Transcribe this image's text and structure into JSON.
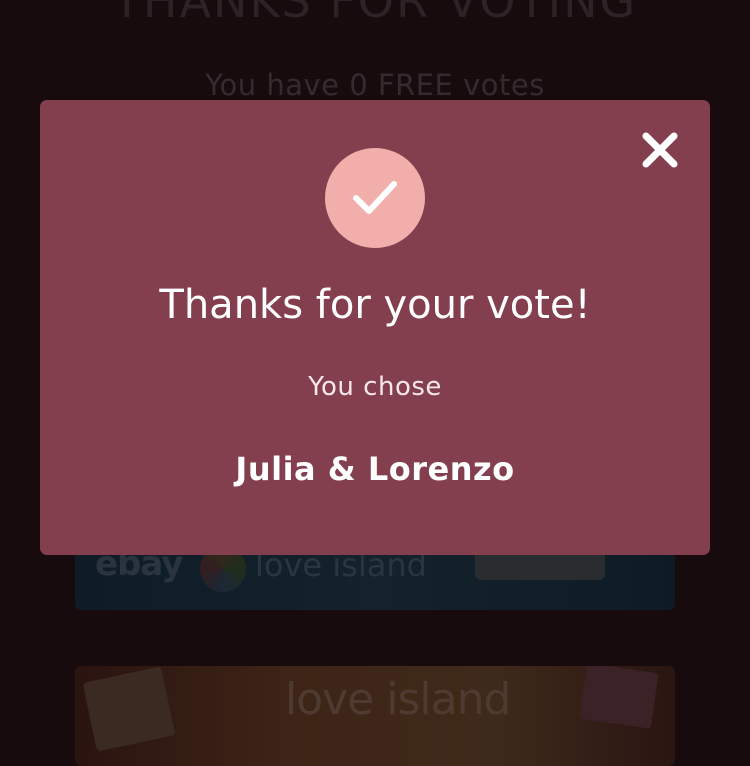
{
  "background": {
    "heading": "THANKS FOR VOTING",
    "votes_text": "You have 0 FREE votes",
    "banners": {
      "ebay_banner": {
        "brand_left": "ebay",
        "brand_right": "love island"
      },
      "love_island_banner": {
        "brand": "love island"
      }
    }
  },
  "modal": {
    "close_icon": "close-icon",
    "check_icon": "check-icon",
    "title": "Thanks for your vote!",
    "subtitle": "You chose",
    "choice": "Julia & Lorenzo"
  },
  "colors": {
    "page_background": "#170b0e",
    "modal_background": "#843f4f",
    "check_circle": "#f1aeab",
    "text_primary": "#ffffff"
  }
}
